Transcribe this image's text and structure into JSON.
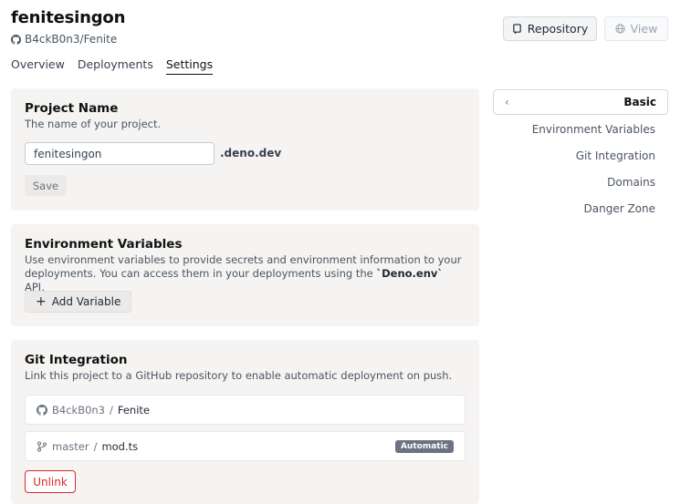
{
  "header": {
    "title": "fenitesingon",
    "repo": "B4ckB0n3/Fenite",
    "buttons": {
      "repository": "Repository",
      "view": "View"
    }
  },
  "tabs": [
    "Overview",
    "Deployments",
    "Settings"
  ],
  "active_tab": "Settings",
  "project_name_card": {
    "title": "Project Name",
    "description": "The name of your project.",
    "input_value": "fenitesingon",
    "suffix": ".deno.dev",
    "save_label": "Save"
  },
  "env_card": {
    "title": "Environment Variables",
    "description_before": "Use environment variables to provide secrets and environment information to your deployments. You can access them in your deployments using the ",
    "description_code": "`Deno.env`",
    "description_after": " API.",
    "add_label": "Add Variable"
  },
  "git_card": {
    "title": "Git Integration",
    "description": "Link this project to a GitHub repository to enable automatic deployment on push.",
    "owner": "B4ckB0n3",
    "repo": "Fenite",
    "separator": "/",
    "branch": "master",
    "entry": "mod.ts",
    "badge": "Automatic",
    "unlink_label": "Unlink"
  },
  "side_nav": {
    "current": "Basic",
    "items": [
      "Environment Variables",
      "Git Integration",
      "Domains",
      "Danger Zone"
    ]
  },
  "colors": {
    "card_bg": "#f5f4f2",
    "danger": "#dc2626",
    "badge_bg": "#6b7280"
  }
}
